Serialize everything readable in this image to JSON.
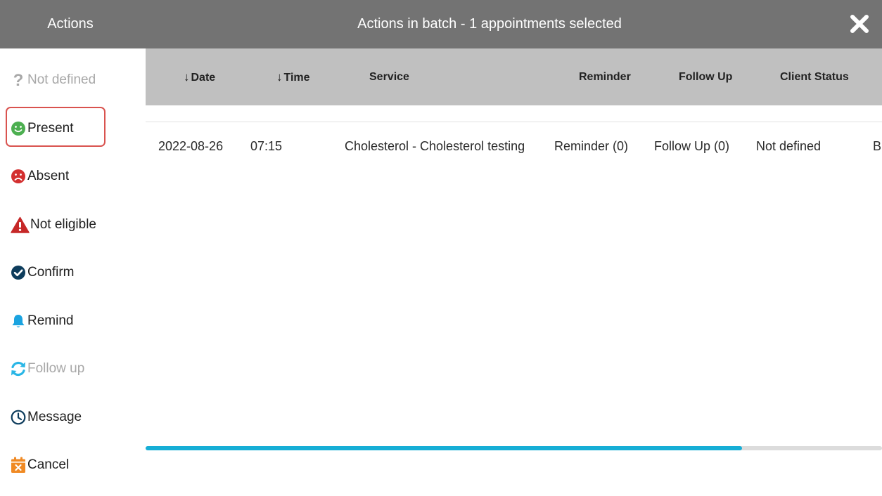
{
  "header": {
    "left_title": "Actions",
    "title": "Actions in batch - 1 appointments selected"
  },
  "actions": [
    {
      "label": "Not defined",
      "icon": "question-icon",
      "enabled": false
    },
    {
      "label": "Present",
      "icon": "smile-icon",
      "enabled": true,
      "selected": true
    },
    {
      "label": "Absent",
      "icon": "sad-icon",
      "enabled": true
    },
    {
      "label": "Not eligible",
      "icon": "warning-icon",
      "enabled": true
    },
    {
      "label": "Confirm",
      "icon": "check-circle-icon",
      "enabled": true
    },
    {
      "label": "Remind",
      "icon": "bell-icon",
      "enabled": true
    },
    {
      "label": "Follow up",
      "icon": "refresh-icon",
      "enabled": false
    },
    {
      "label": "Message",
      "icon": "clock-icon",
      "enabled": true
    },
    {
      "label": "Cancel",
      "icon": "calendar-cancel-icon",
      "enabled": true
    }
  ],
  "table": {
    "columns": {
      "date": "Date",
      "time": "Time",
      "service": "Service",
      "reminder": "Reminder",
      "follow_up": "Follow Up",
      "client_status": "Client Status"
    },
    "sort_arrow": "↓",
    "rows": [
      {
        "date": "2022-08-26",
        "time": "07:15",
        "service": "Cholesterol - Cholesterol testing",
        "reminder": "Reminder (0)",
        "follow_up": "Follow Up (0)",
        "client_status": "Not defined",
        "truncated": "B"
      }
    ]
  },
  "scrollbar": {
    "position_fraction": 0.81
  },
  "colors": {
    "header_bg": "#737373",
    "table_header_bg": "#c0c0c0",
    "selected_border": "#d9534f",
    "scroll_thumb": "#16aed6",
    "present_green": "#4caf50",
    "absent_red": "#d32f2f",
    "confirm_navy": "#0d3c5c",
    "remind_blue": "#1aa3e0",
    "followup_cyan": "#29b6e6",
    "cancel_orange": "#f08a24"
  }
}
